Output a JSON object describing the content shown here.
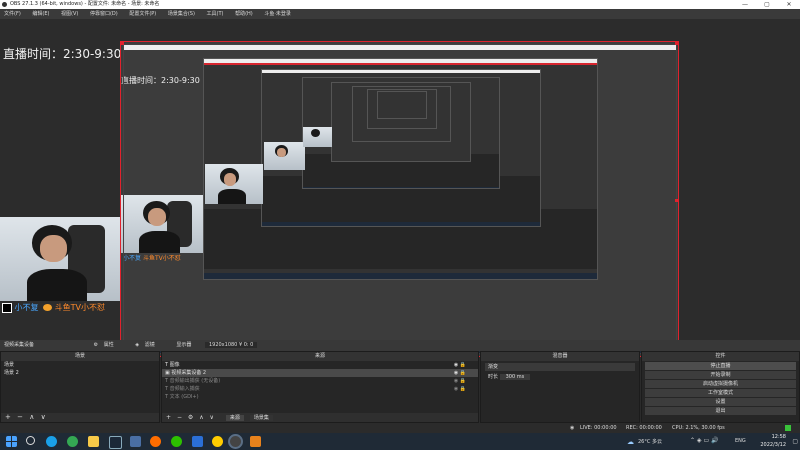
{
  "window": {
    "title": "OBS 27.1.3 (64-bit, windows) - 配置文件: 未命名 - 场景: 未命名",
    "controls": [
      "—",
      "▢",
      "✕"
    ]
  },
  "menu": [
    "文件(F)",
    "编辑(E)",
    "视图(V)",
    "停靠窗口(D)",
    "配置文件(P)",
    "场景集合(S)",
    "工具(T)",
    "帮助(H)",
    "斗鱼·未登录"
  ],
  "overlay": {
    "schedule": "直播时间：2:30-9:30",
    "weibo": "小不复",
    "douyu": "斗鱼TV小不怼"
  },
  "source_toolbar": {
    "selected_source": "视频采集设备",
    "props": "属性",
    "filters": "滤镜",
    "device_label": "显示器",
    "device_value": "1920x1080 ¥ 0: 0"
  },
  "scenes": {
    "title": "场景",
    "items": [
      "场景",
      "场景 2"
    ]
  },
  "sources": {
    "title": "来源",
    "items": [
      "图像",
      "视频采集设备 2",
      "音频输出捕获 (无设备)",
      "音频输入捕获",
      "文本 (GDI+)"
    ],
    "tabs": [
      "来源",
      "场景集"
    ]
  },
  "mixer": {
    "title": "混音器"
  },
  "transitions": {
    "title": "场景转场",
    "type": "渐变",
    "duration_label": "时长",
    "duration_value": "300 ms"
  },
  "controls": {
    "title": "控件",
    "buttons": [
      "停止直播",
      "开始录制",
      "启动虚拟摄像机",
      "工作室模式",
      "设置",
      "退出"
    ]
  },
  "status": {
    "live": "LIVE: 00:00:00",
    "rec": "REC: 00:00:00",
    "cpu": "CPU: 2.1%, 30.00 fps"
  },
  "taskbar": {
    "weather": "26°C 多云",
    "lang": "ENG",
    "time": "12:58",
    "date": "2022/3/12"
  },
  "colors": {
    "selection_border": "#e0222d",
    "panel_bg": "#262626",
    "taskbar_bg": "#1f2a36"
  }
}
